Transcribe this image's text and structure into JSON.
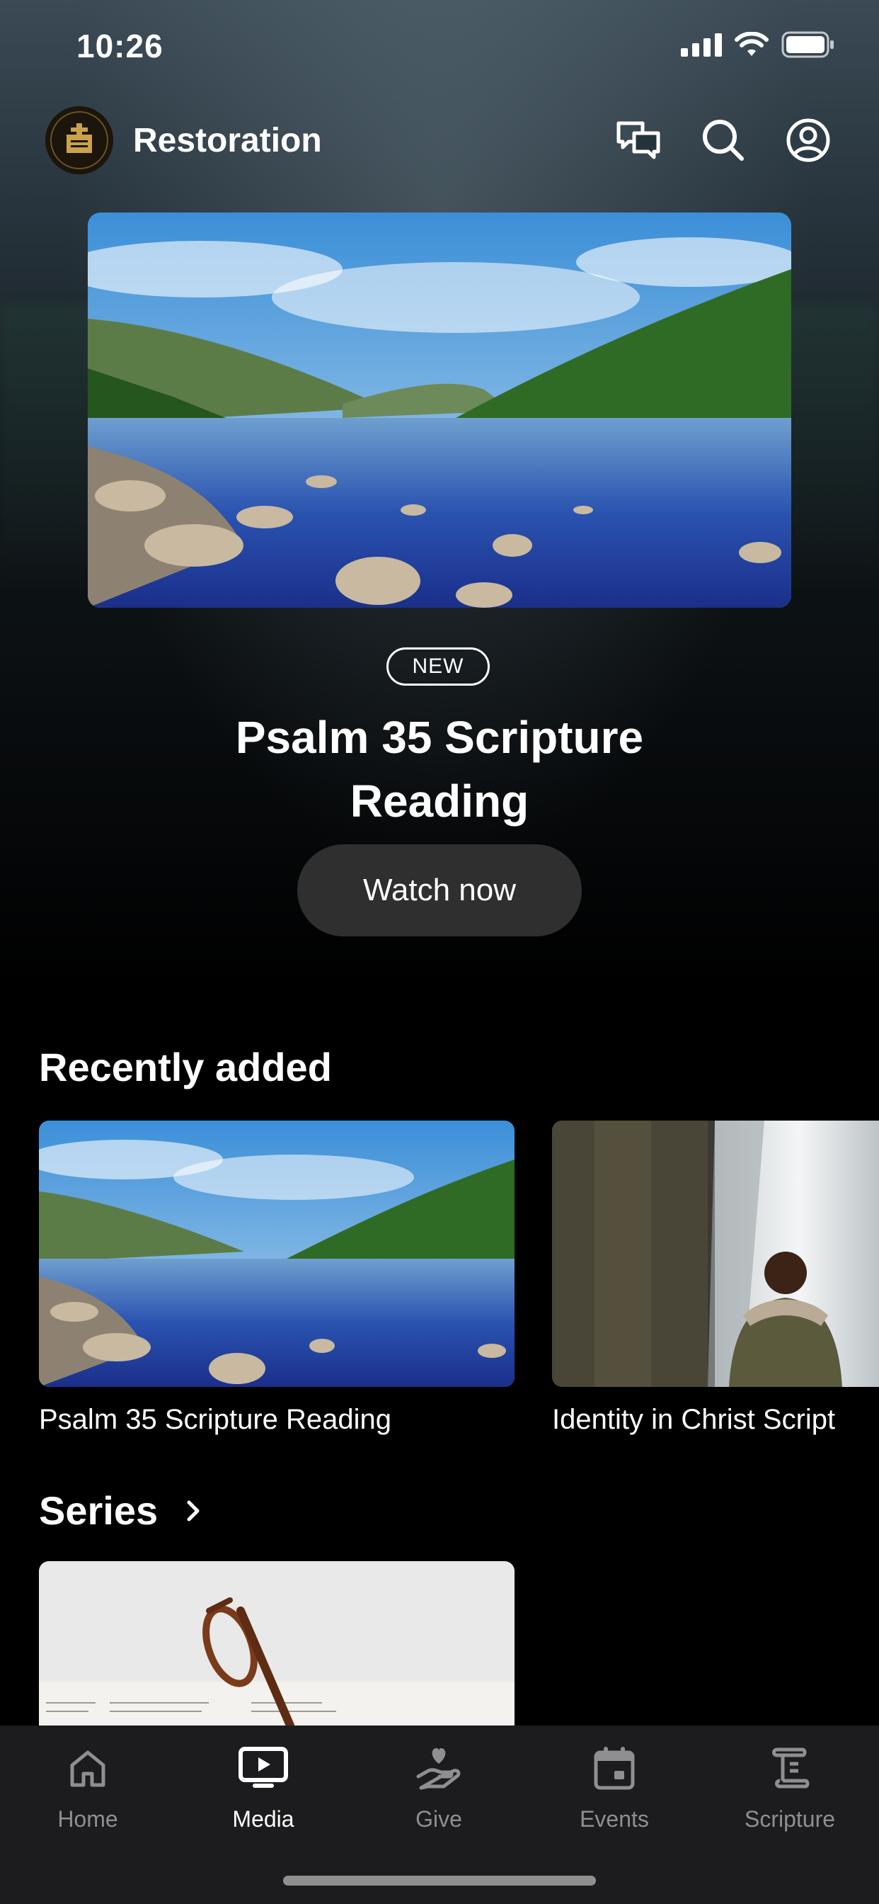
{
  "status_bar": {
    "time": "10:26"
  },
  "header": {
    "app_name": "Restoration",
    "actions": [
      "chat-icon",
      "search-icon",
      "profile-icon"
    ]
  },
  "featured": {
    "badge": "NEW",
    "title": "Psalm 35 Scripture Reading",
    "button": "Watch now"
  },
  "recently_added": {
    "title": "Recently added",
    "items": [
      {
        "label": "Psalm 35 Scripture Reading"
      },
      {
        "label": "Identity in Christ Script"
      }
    ]
  },
  "series": {
    "title": "Series"
  },
  "tabbar": {
    "items": [
      {
        "label": "Home",
        "icon": "home-icon",
        "active": false
      },
      {
        "label": "Media",
        "icon": "tv-icon",
        "active": true
      },
      {
        "label": "Give",
        "icon": "give-icon",
        "active": false
      },
      {
        "label": "Events",
        "icon": "calendar-icon",
        "active": false
      },
      {
        "label": "Scripture",
        "icon": "scroll-icon",
        "active": false
      }
    ]
  },
  "colors": {
    "background": "#000000",
    "button": "#2f2f2f",
    "tabbar": "#1c1c1e",
    "inactive_tab": "#8e8e93"
  }
}
